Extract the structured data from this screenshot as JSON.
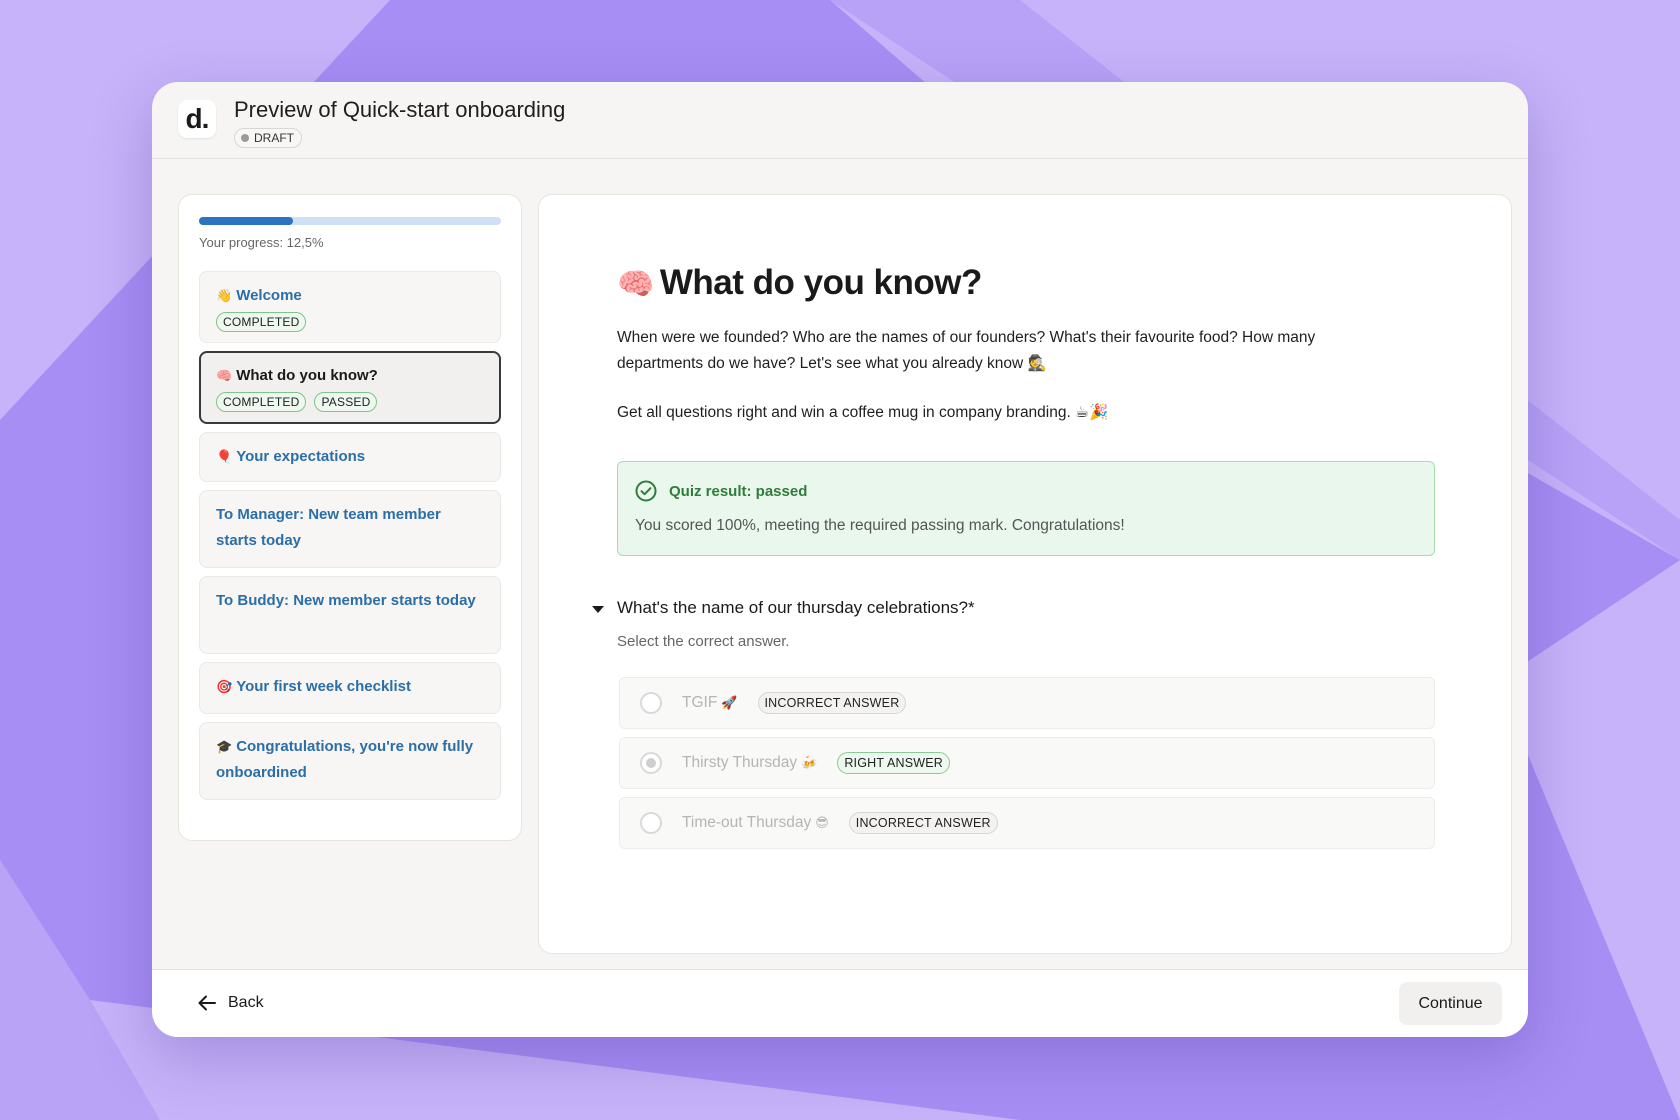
{
  "header": {
    "logo_text": "d.",
    "title": "Preview of Quick-start onboarding",
    "status": "DRAFT"
  },
  "sidebar": {
    "progress_label": "Your progress: 12,5%",
    "progress_fraction": 0.125,
    "steps": [
      {
        "emoji": "👋",
        "label": "Welcome",
        "badges": [
          "COMPLETED"
        ]
      },
      {
        "emoji": "🧠",
        "label": "What do you know?",
        "badges": [
          "COMPLETED",
          "PASSED"
        ]
      },
      {
        "emoji": "🎈",
        "label": "Your expectations",
        "badges": []
      },
      {
        "emoji": "",
        "label": "To Manager: New team member starts today",
        "badges": []
      },
      {
        "emoji": "",
        "label": "To Buddy: New member starts today",
        "badges": []
      },
      {
        "emoji": "🎯",
        "label": "Your first week checklist",
        "badges": []
      },
      {
        "emoji": "🎓",
        "label": "Congratulations, you're now fully onboardined",
        "badges": []
      }
    ]
  },
  "main": {
    "heading_emoji": "🧠",
    "heading": "What do you know?",
    "description": "When were we founded? Who are the names of our founders? What's their favourite food? How many departments do we have? Let's see what you already know 🕵️",
    "description2": "Get all questions right and win a coffee mug in company branding. ☕🎉",
    "result": {
      "title": "Quiz result: passed",
      "text": "You scored 100%, meeting the required passing mark. Congratulations!"
    },
    "question": "What's the name of our thursday celebrations?*",
    "hint": "Select the correct answer.",
    "options": [
      {
        "label": "TGIF",
        "emoji": "🚀",
        "badge": "INCORRECT ANSWER",
        "selected": false
      },
      {
        "label": "Thirsty Thursday",
        "emoji": "🍻",
        "badge": "RIGHT ANSWER",
        "selected": true
      },
      {
        "label": "Time-out Thursday",
        "emoji": "😎",
        "badge": "INCORRECT ANSWER",
        "selected": false
      }
    ]
  },
  "footer": {
    "back_label": "Back",
    "continue_label": "Continue"
  }
}
